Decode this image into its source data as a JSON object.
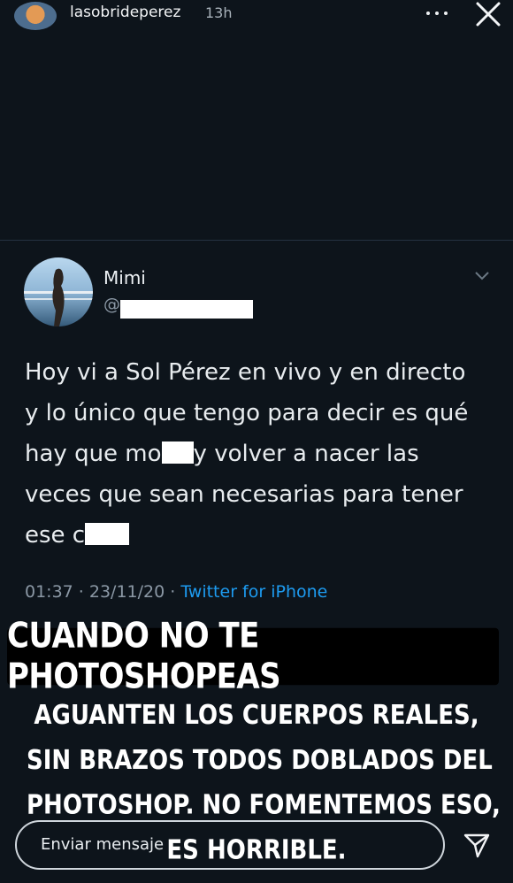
{
  "story": {
    "username": "lasobrideperez",
    "time": "13h",
    "icons": {
      "more": "more-dots-icon",
      "close": "close-icon",
      "send": "send-icon"
    }
  },
  "tweet": {
    "name": "Mimi",
    "handle_visible": "@",
    "lines": [
      {
        "before": "Hoy vi a Sol Pérez en vivo y en directo",
        "after": ""
      },
      {
        "before": "y lo único que tengo para decir es qué",
        "after": ""
      },
      {
        "before": "hay que mo",
        "after": "y volver a nacer las"
      },
      {
        "before": "veces que sean necesarias para tener",
        "after": ""
      },
      {
        "before": "ese c",
        "after": ""
      }
    ],
    "timestamp": "01:37 · 23/11/20 · ",
    "source": "Twitter for iPhone"
  },
  "overlay": {
    "title": "CUANDO NO TE PHOTOSHOPEAS",
    "caption_lines": [
      "AGUANTEN LOS CUERPOS REALES,",
      "SIN BRAZOS TODOS DOBLADOS DEL",
      "PHOTOSHOP. NO FOMENTEMOS ESO,",
      "ES HORRIBLE."
    ]
  },
  "reply": {
    "placeholder": "Enviar mensaje"
  },
  "colors": {
    "background": "#0d141b",
    "link": "#1d9bf0",
    "muted": "#8b98a5"
  }
}
